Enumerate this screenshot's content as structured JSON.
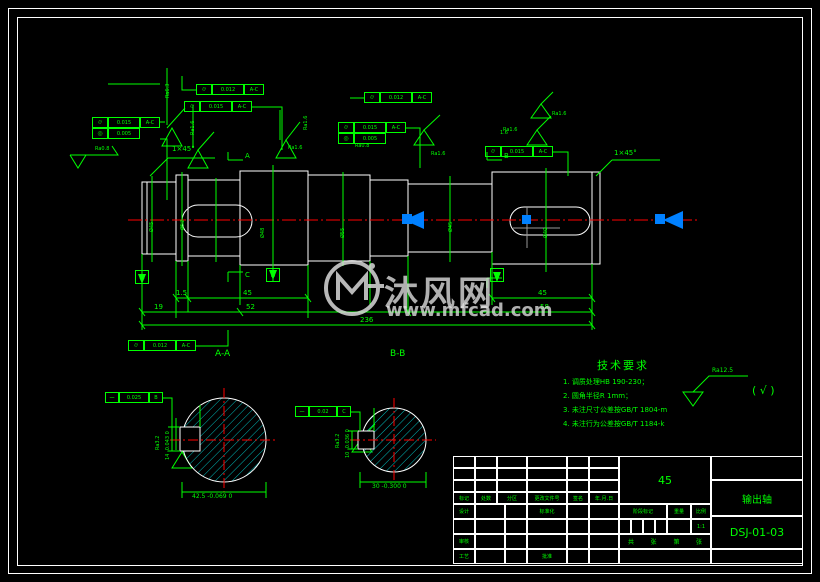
{
  "meta": {
    "drawing_type": "CAD mechanical part drawing",
    "background": "#000000",
    "line_color_primary": "#00ff00",
    "line_color_part": "#ffffff",
    "line_color_centerline": "#ff0000",
    "hatch_color": "#00bbbb"
  },
  "watermark": {
    "logo_text": "MF",
    "brand_cn": "沐风网",
    "url": "www.mfcad.com"
  },
  "technical_requirements": {
    "title": "技术要求",
    "items": [
      "1. 调质处理HB 190-230；",
      "2. 圆角半径R 1mm；",
      "3. 未注尺寸公差按GB/T 1804-m",
      "4. 未注行为公差按GB/T 1184-k"
    ],
    "surface_note": "Ra12.5",
    "surface_paren": "( √ )"
  },
  "title_block": {
    "revision_headers": [
      "标记",
      "处数",
      "分区",
      "更改文件号",
      "签名",
      "年.月.日"
    ],
    "roles_left": [
      "设计",
      "",
      "审核",
      "工艺"
    ],
    "roles_mid": [
      "标准化",
      "",
      "",
      "批准"
    ],
    "material": "45",
    "stage_label": "阶段标记",
    "weight_label": "重量",
    "scale_label": "比例",
    "scale_value": "1:1",
    "sheet_row": [
      "共",
      "张",
      "第",
      "张"
    ],
    "part_name": "输出轴",
    "part_number": "DSJ-01-03"
  },
  "main_view": {
    "chamfer_left": "1×45°",
    "chamfer_right": "1×45°",
    "section_marks": [
      "A",
      "A",
      "B",
      "B",
      "C",
      "C"
    ],
    "roughness_labels": [
      "Ra0.8",
      "Ra1.6",
      "Ra6.3",
      "Ra1.6",
      "Ra1.6",
      "Ra1.6",
      "Ra0.8",
      "Ra1.6",
      "Ra1.6"
    ],
    "roughness_extra": "1.6",
    "gtol_frames": [
      {
        "sym": "⌭",
        "val": "0.015",
        "datum": "A-C"
      },
      {
        "sym": "◎",
        "val": "0.005",
        "datum": ""
      },
      {
        "sym": "⌭",
        "val": "0.012",
        "datum": "A-C"
      },
      {
        "sym": "⌭",
        "val": "0.015",
        "datum": "A-C"
      },
      {
        "sym": "◎",
        "val": "0.005",
        "datum": ""
      },
      {
        "sym": "⌭",
        "val": "0.012",
        "datum": "A-C"
      },
      {
        "sym": "⌭",
        "val": "0.015",
        "datum": "A-C"
      },
      {
        "sym": "⌭",
        "val": "0.012",
        "datum": "A-C"
      }
    ],
    "horizontal_dims": [
      "19",
      "1.5",
      "45",
      "52",
      "45",
      "58",
      "236"
    ],
    "diameter_dims": [
      "Ø45",
      "Ø52",
      "Ø48",
      "Ø55",
      "Ø45",
      "Ø40"
    ]
  },
  "section_aa": {
    "label": "A-A",
    "gtol": {
      "sym": "⏤",
      "val": "0.025",
      "datum": "B"
    },
    "keyway_width": "14 -0.043 0",
    "diameter": "42.5 -0.069 0",
    "roughness": "Ra3.2"
  },
  "section_bb": {
    "label": "B-B",
    "gtol": {
      "sym": "⏤",
      "val": "0.02",
      "datum": "C"
    },
    "keyway_width": "10 -0.036 0",
    "diameter": "30 -0.300 0",
    "roughness": "Ra3.2"
  }
}
